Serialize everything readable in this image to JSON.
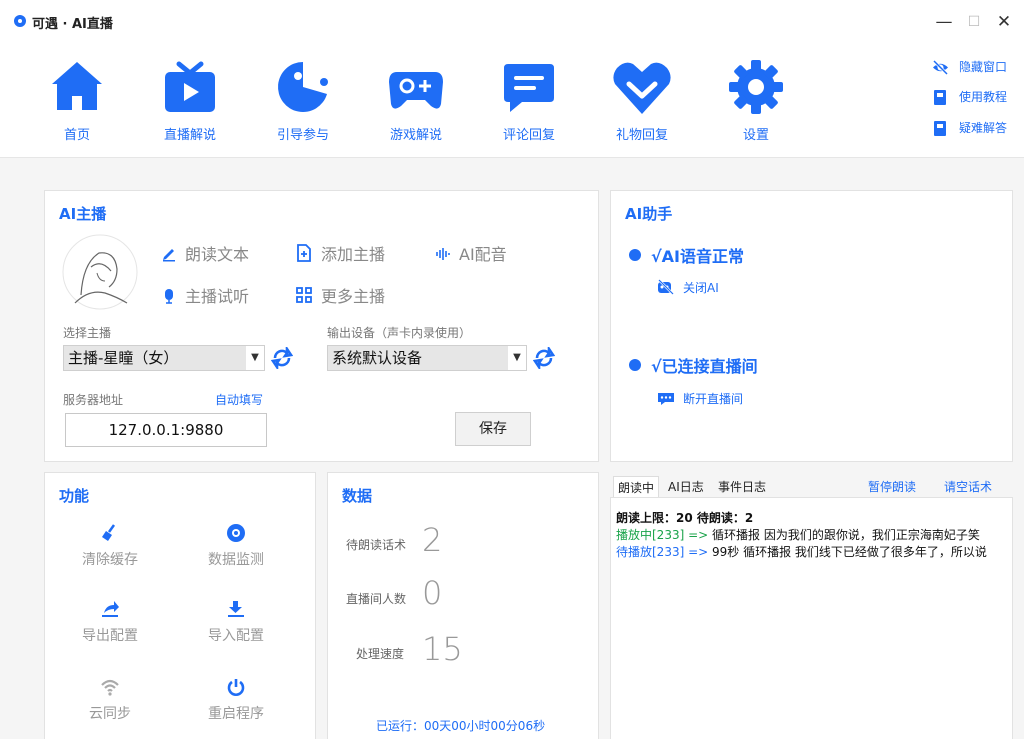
{
  "window": {
    "title": "可遇 · AI直播",
    "minimize": "—",
    "maximize": "☐",
    "close": "✕"
  },
  "nav": {
    "items": [
      {
        "label": "首页"
      },
      {
        "label": "直播解说"
      },
      {
        "label": "引导参与"
      },
      {
        "label": "游戏解说"
      },
      {
        "label": "评论回复"
      },
      {
        "label": "礼物回复"
      },
      {
        "label": "设置"
      }
    ],
    "side_links": [
      {
        "label": "隐藏窗口"
      },
      {
        "label": "使用教程"
      },
      {
        "label": "疑难解答"
      }
    ]
  },
  "ai_anchor": {
    "title": "AI主播",
    "actions": {
      "read_text": "朗读文本",
      "add_anchor": "添加主播",
      "ai_dub": "AI配音",
      "preview": "主播试听",
      "more_anchors": "更多主播"
    },
    "select_anchor_label": "选择主播",
    "selected_anchor": "主播-星瞳（女）",
    "output_device_label": "输出设备（声卡内录使用）",
    "selected_device": "系统默认设备",
    "server_label": "服务器地址",
    "auto_fill": "自动填写",
    "server_address": "127.0.0.1:9880",
    "save": "保存"
  },
  "ai_assistant": {
    "title": "AI助手",
    "voice_status": "√AI语音正常",
    "close_ai": "关闭AI",
    "live_status": "√已连接直播间",
    "disconnect": "断开直播间"
  },
  "functions": {
    "title": "功能",
    "items": [
      {
        "label": "清除缓存"
      },
      {
        "label": "数据监测"
      },
      {
        "label": "导出配置"
      },
      {
        "label": "导入配置"
      },
      {
        "label": "云同步"
      },
      {
        "label": "重启程序"
      }
    ]
  },
  "stats": {
    "title": "数据",
    "pending_label": "待朗读话术",
    "pending_value": "2",
    "viewers_label": "直播间人数",
    "viewers_value": "0",
    "speed_label": "处理速度",
    "speed_value": "15",
    "runtime": "已运行：00天00小时00分06秒"
  },
  "log": {
    "tabs": [
      "朗读中",
      "AI日志",
      "事件日志"
    ],
    "pause": "暂停朗读",
    "clear": "请空话术",
    "line1": "朗读上限：20 待朗读：2",
    "line2_tag": "播放中[233] => ",
    "line2_text": "循环播报 因为我们的跟你说，我们正宗海南妃子笑",
    "line3_tag": "待播放[233] => ",
    "line3_text": "99秒 循环播报 我们线下已经做了很多年了，所以说"
  },
  "colors": {
    "accent": "#1f6df5",
    "green": "#1aa34a"
  }
}
